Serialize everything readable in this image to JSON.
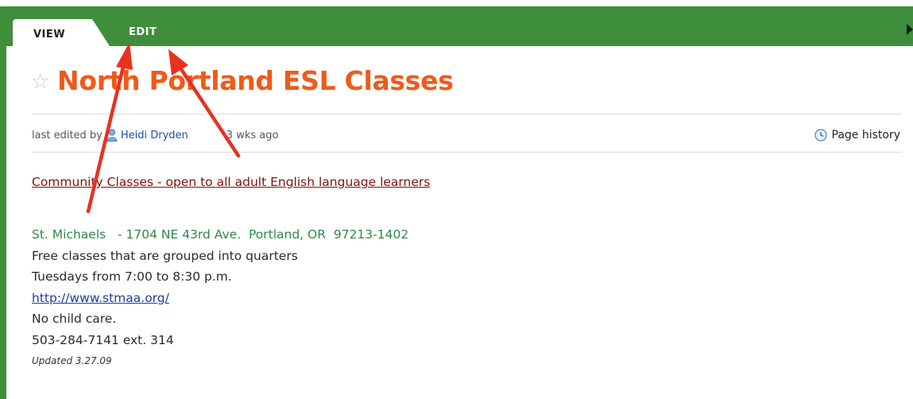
{
  "tabs": {
    "view_label": "VIEW",
    "edit_label": "EDIT"
  },
  "page": {
    "title": "North Portland ESL Classes",
    "meta": {
      "prefix": "last edited by",
      "editor": "Heidi Dryden",
      "time": "3 wks ago"
    },
    "history_label": "Page history"
  },
  "content": {
    "heading": "Community Classes - open to all adult English language learners",
    "address": "St. Michaels   - 1704 NE 43rd Ave.  Portland, OR  97213-1402",
    "line1": "Free classes that are grouped into quarters",
    "line2": "Tuesdays from 7:00 to 8:30 p.m.",
    "url": "http://www.stmaa.org/",
    "line3": "No child care.",
    "line4": "503-284-7141 ext. 314",
    "updated": "Updated 3.27.09"
  },
  "colors": {
    "tab_green": "#3f8e3c",
    "title_orange": "#f05a1a",
    "annotation_red": "#e8321e",
    "address_green": "#2c8a4a",
    "link_blue": "#1a3fa0"
  },
  "icons": [
    "star-icon",
    "user-icon",
    "clock-icon",
    "scroll-right-icon"
  ]
}
